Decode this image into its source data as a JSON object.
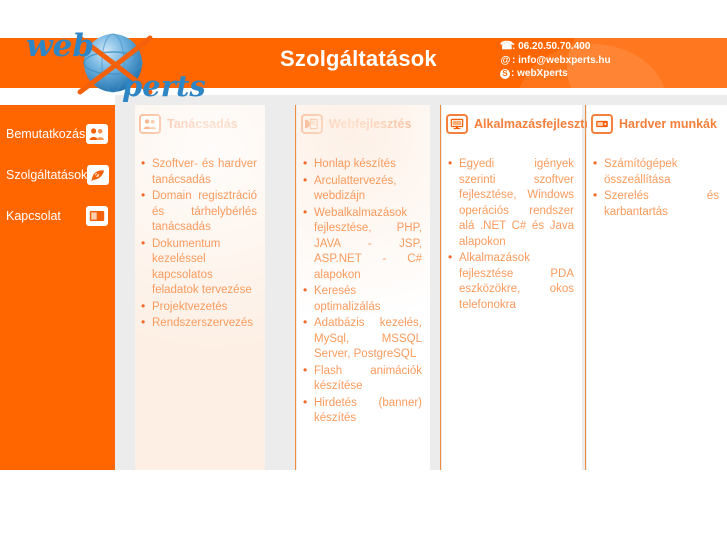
{
  "header": {
    "title": "Szolgáltatások",
    "logo_text_1": "web",
    "logo_text_2": "perts",
    "contact": [
      {
        "icon": "phone-icon",
        "glyph": "☎",
        "text": ": 06.20.50.70.400"
      },
      {
        "icon": "email-icon",
        "glyph": "@",
        "text": ": info@webxperts.hu"
      },
      {
        "icon": "skype-icon",
        "glyph": "S",
        "text": ": webXperts"
      }
    ]
  },
  "sidebar": {
    "items": [
      {
        "label": "Bemutatkozás",
        "icon": "people-icon"
      },
      {
        "label": "Szolgáltatások",
        "icon": "satellite-dish-icon"
      },
      {
        "label": "Kapcsolat",
        "icon": "contact-card-icon"
      }
    ]
  },
  "columns": [
    {
      "title": "Tanácsadás",
      "icon": "people-icon",
      "items": [
        "Szoftver- és hardver tanácsadás",
        "Domain regisztráció és tárhelybérlés tanácsadás",
        "Dokumentum kezeléssel kapcsolatos feladatok tervezése",
        "Projektvezetés",
        "Rendszerszervezés"
      ]
    },
    {
      "title": "Webfejlesztés",
      "icon": "document-chart-icon",
      "items": [
        "Honlap készítés",
        "Arculattervezés, webdizájn",
        "Webalkalmazások fejlesztése, PHP, JAVA - JSP, ASP.NET - C# alapokon",
        "Keresés optimalizálás",
        "Adatbázis kezelés, MySql, MSSQL Server, PostgreSQL",
        "Flash animációk készítése",
        "Hirdetés (banner) készítés"
      ]
    },
    {
      "title": "Alkalmazásfejlesztés",
      "icon": "monitor-icon",
      "items": [
        "Egyedi igények szerinti szoftver fejlesztése, Windows operációs rendszer alá .NET C# és Java alapokon",
        "Alkalmazások fejlesztése PDA eszközökre, okos telefonokra"
      ]
    },
    {
      "title": "Hardver munkák",
      "icon": "hardware-icon",
      "items": [
        "Számítógépek összeállítása",
        "Szerelés és karbantartás"
      ]
    }
  ],
  "colors": {
    "brand_orange": "#ff6600",
    "text_orange": "#fa9b5e",
    "heading_orange": "#f5803c",
    "content_gray": "#ececec",
    "col1_bg": "#fdefe4"
  }
}
